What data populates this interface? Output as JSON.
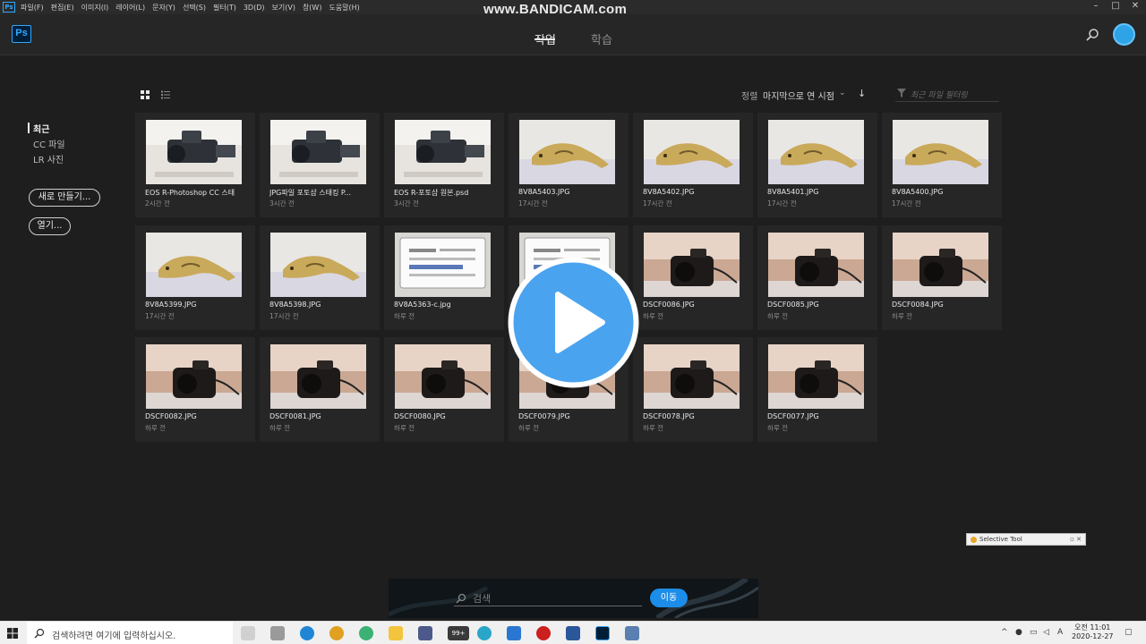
{
  "menubar": {
    "app_badge": "Ps",
    "items": [
      "파일(F)",
      "편집(E)",
      "이미지(I)",
      "레이어(L)",
      "문자(Y)",
      "선택(S)",
      "필터(T)",
      "3D(D)",
      "보기(V)",
      "창(W)",
      "도움말(H)"
    ],
    "watermark": "www.BANDICAM.com",
    "minimize": "–",
    "maximize": "□",
    "close": "✕"
  },
  "header": {
    "logo": "Ps",
    "tabs": [
      {
        "label": "작업",
        "active": true
      },
      {
        "label": "학습",
        "active": false
      }
    ],
    "accent": "#31a8ff"
  },
  "sidebar": {
    "items": [
      {
        "label": "최근",
        "active": true
      },
      {
        "label": "CC 파일",
        "active": false
      },
      {
        "label": "LR 사진",
        "active": false
      }
    ],
    "new_button": "새로 만들기...",
    "open_button": "열기..."
  },
  "toolbar": {
    "sort_label": "정렬",
    "sort_value": "마지막으로 연 시점",
    "filter_placeholder": "최근 파일 필터링"
  },
  "files": [
    {
      "name": "EOS R-Photoshop CC 스태",
      "time": "2시간 전",
      "thumb": "camera-light"
    },
    {
      "name": "JPG파일 포토샵 스태킹 P...",
      "time": "3시간 전",
      "thumb": "camera-light"
    },
    {
      "name": "EOS R-포토샵 원본.psd",
      "time": "3시간 전",
      "thumb": "camera-light"
    },
    {
      "name": "8V8A5403.JPG",
      "time": "17시간 전",
      "thumb": "lizard"
    },
    {
      "name": "8V8A5402.JPG",
      "time": "17시간 전",
      "thumb": "lizard"
    },
    {
      "name": "8V8A5401.JPG",
      "time": "17시간 전",
      "thumb": "lizard"
    },
    {
      "name": "8V8A5400.JPG",
      "time": "17시간 전",
      "thumb": "lizard"
    },
    {
      "name": "8V8A5399.JPG",
      "time": "17시간 전",
      "thumb": "lizard"
    },
    {
      "name": "8V8A5398.JPG",
      "time": "17시간 전",
      "thumb": "lizard"
    },
    {
      "name": "8V8A5363-c.jpg",
      "time": "하루 전",
      "thumb": "label"
    },
    {
      "name": "",
      "time": "",
      "thumb": "label"
    },
    {
      "name": "DSCF0086.JPG",
      "time": "하루 전",
      "thumb": "camera-warm"
    },
    {
      "name": "DSCF0085.JPG",
      "time": "하루 전",
      "thumb": "camera-warm"
    },
    {
      "name": "DSCF0084.JPG",
      "time": "하루 전",
      "thumb": "camera-warm"
    },
    {
      "name": "DSCF0082.JPG",
      "time": "하루 전",
      "thumb": "camera-warm"
    },
    {
      "name": "DSCF0081.JPG",
      "time": "하루 전",
      "thumb": "camera-warm"
    },
    {
      "name": "DSCF0080.JPG",
      "time": "하루 전",
      "thumb": "camera-warm"
    },
    {
      "name": "DSCF0079.JPG",
      "time": "하루 전",
      "thumb": "camera-warm"
    },
    {
      "name": "DSCF0078.JPG",
      "time": "하루 전",
      "thumb": "camera-warm"
    },
    {
      "name": "DSCF0077.JPG",
      "time": "하루 전",
      "thumb": "camera-warm"
    }
  ],
  "overlay": {
    "play_color": "#4aa3ef"
  },
  "selective_tool": {
    "title": "Selective Tool"
  },
  "bottom_search": {
    "placeholder": "검색",
    "button": "이동"
  },
  "taskbar": {
    "search_text": "검색하려면 여기에 입력하십시오.",
    "badge": "99+",
    "time": "오전 11:01",
    "date": "2020-12-27",
    "ime": "A"
  }
}
